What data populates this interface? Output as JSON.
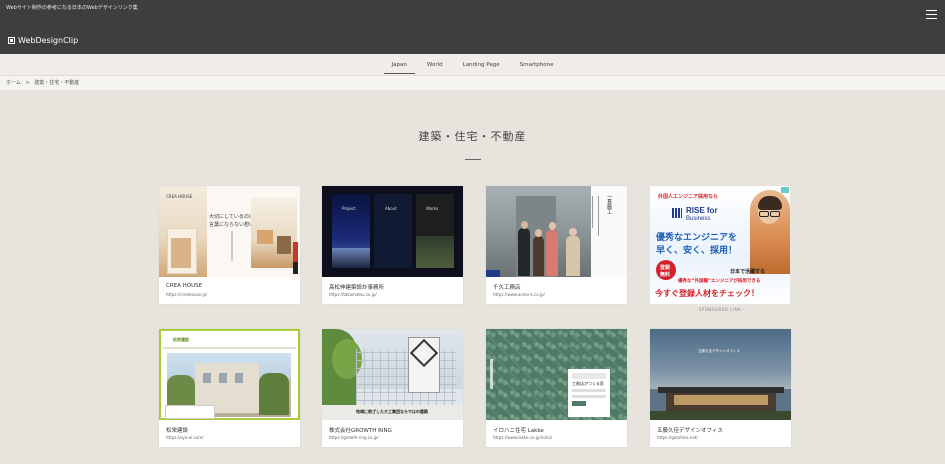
{
  "header": {
    "tagline": "Webサイト制作の参考になる日本のWebデザインリンク集",
    "logo_text": "WebDesignClip"
  },
  "tabs": [
    {
      "label": "Japan",
      "active": true
    },
    {
      "label": "World",
      "active": false
    },
    {
      "label": "Landing Page",
      "active": false
    },
    {
      "label": "Smartphone",
      "active": false
    }
  ],
  "breadcrumb": {
    "home": "ホーム",
    "separator": ">",
    "current": "建築・住宅・不動産"
  },
  "page_title": "建築・住宅・不動産",
  "cards": [
    {
      "name": "CREA HOUSE",
      "url": "https://creahouse.jp/",
      "thumb": {
        "logo": "CREA HOUSE",
        "headline": "大切にしているのは",
        "headline2": "言葉にならない想い。"
      }
    },
    {
      "name": "髙松伸建築設計事務所",
      "url": "https://takamatsu.co.jp/",
      "thumb": {
        "p1": "Project",
        "p2": "About",
        "p3": "Works"
      }
    },
    {
      "name": "千久工務店",
      "url": "https://www.asmo-k.co.jp/",
      "thumb": {
        "vertical": "一貫施工"
      }
    },
    {
      "name": "松栄建設",
      "url": "https://syo-ei.com/",
      "thumb": {
        "logo": "松栄建設"
      }
    },
    {
      "name": "株式会社GROWTH RING",
      "url": "https://growth-ring.co.jp/",
      "thumb": {
        "caption": "地域に根ざした大工集団ならではの建築"
      }
    },
    {
      "name": "イロハニ住宅 Lakke",
      "url": "https://www.lakke.co.jp/iroha/",
      "thumb": {
        "text": "工務店がつくる家"
      }
    },
    {
      "name": "五藤久佳デザインオフィス",
      "url": "https://gotohisa.net/",
      "thumb": {
        "text": "五藤久佳デザインオフィス"
      }
    }
  ],
  "ad": {
    "top": "外国人エンジニア採用なら",
    "brand1": "RISE for",
    "brand2": "Business",
    "line1": "優秀なエンジニアを",
    "line2": "早く、安く、採用！",
    "badge1": "登録",
    "badge2": "無料",
    "sub": "日本で活躍する",
    "sub2": "優秀な“外国籍”エンジニアが採用できる",
    "cta": "今すぐ登録人材をチェック！",
    "label": "- SPONSORED LINK -"
  },
  "colors": {
    "header_bg": "#3e3e3e",
    "page_bg": "#e7e3dd",
    "ad_blue": "#1f5fb8",
    "ad_red": "#d4222a"
  }
}
